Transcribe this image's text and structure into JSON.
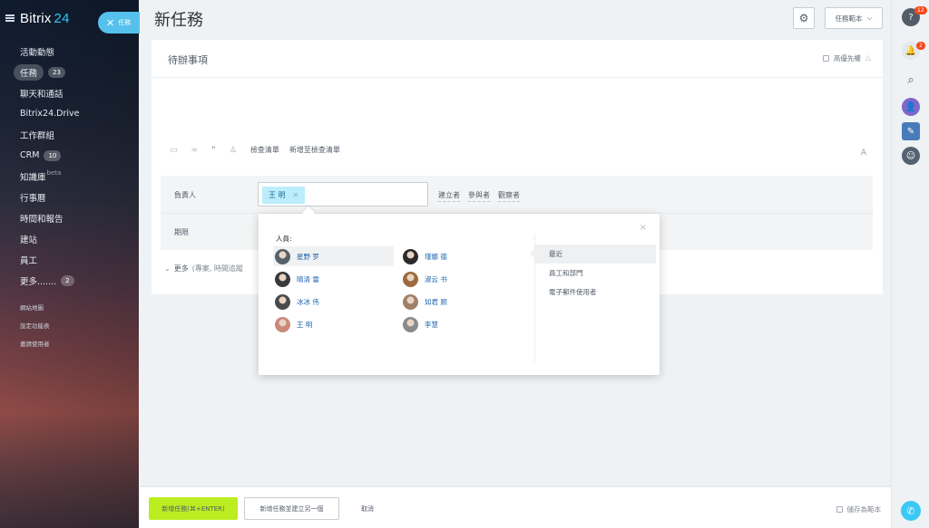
{
  "sidebar": {
    "logo_text": "Bitrix",
    "logo_num": "24",
    "task_pill": "任務",
    "items": [
      {
        "label": "活動動態"
      },
      {
        "label": "任務",
        "badge": "23"
      },
      {
        "label": "聊天和通話"
      },
      {
        "label": "Bitrix24.Drive"
      },
      {
        "label": "工作群組"
      },
      {
        "label": "CRM",
        "badge": "10"
      },
      {
        "label": "知識庫",
        "sup": "beta"
      },
      {
        "label": "行事曆"
      },
      {
        "label": "時間和報告"
      },
      {
        "label": "建站"
      },
      {
        "label": "員工"
      },
      {
        "label": "更多.......",
        "badge": "2"
      }
    ],
    "mini": [
      "網站地圖",
      "設定功能表",
      "邀請使用者"
    ]
  },
  "header": {
    "title": "新任務",
    "template_button": "任務範本"
  },
  "form": {
    "placeholder_title": "待辦事項",
    "priority_label": "高優先權",
    "toolbar": [
      "檢查清單",
      "新增至檢查清單"
    ],
    "assignee_label": "負責人",
    "assignee_chip": "王 明",
    "roles": [
      "建立者",
      "參與者",
      "觀察者"
    ],
    "deadline_label": "期限",
    "more_label": "更多",
    "more_desc": "(專案, 時間追蹤"
  },
  "popup": {
    "people_label": "人員:",
    "people": [
      {
        "name": "星野 罗",
        "color": "#55606b"
      },
      {
        "name": "瑾娜 德",
        "color": "#2b2b2b"
      },
      {
        "name": "晴清 雷",
        "color": "#3a3a3a"
      },
      {
        "name": "淑云 书",
        "color": "#9c6a3e"
      },
      {
        "name": "冰冰 伟",
        "color": "#4a4a4a"
      },
      {
        "name": "如君 顾",
        "color": "#a0806a"
      },
      {
        "name": "王 明",
        "color": "#c98a7a"
      },
      {
        "name": "李慧",
        "color": "#8a8a8a"
      }
    ],
    "tabs": [
      "最近",
      "員工和部門",
      "電子郵件使用者"
    ]
  },
  "footer": {
    "add_button": "新增任務(⌘+ENTER)",
    "add_another_button": "新增任務並建立另一個",
    "cancel": "取消",
    "save_template": "儲存為範本"
  },
  "rightbar": {
    "help_badge": "12",
    "notif_badge": "2"
  }
}
